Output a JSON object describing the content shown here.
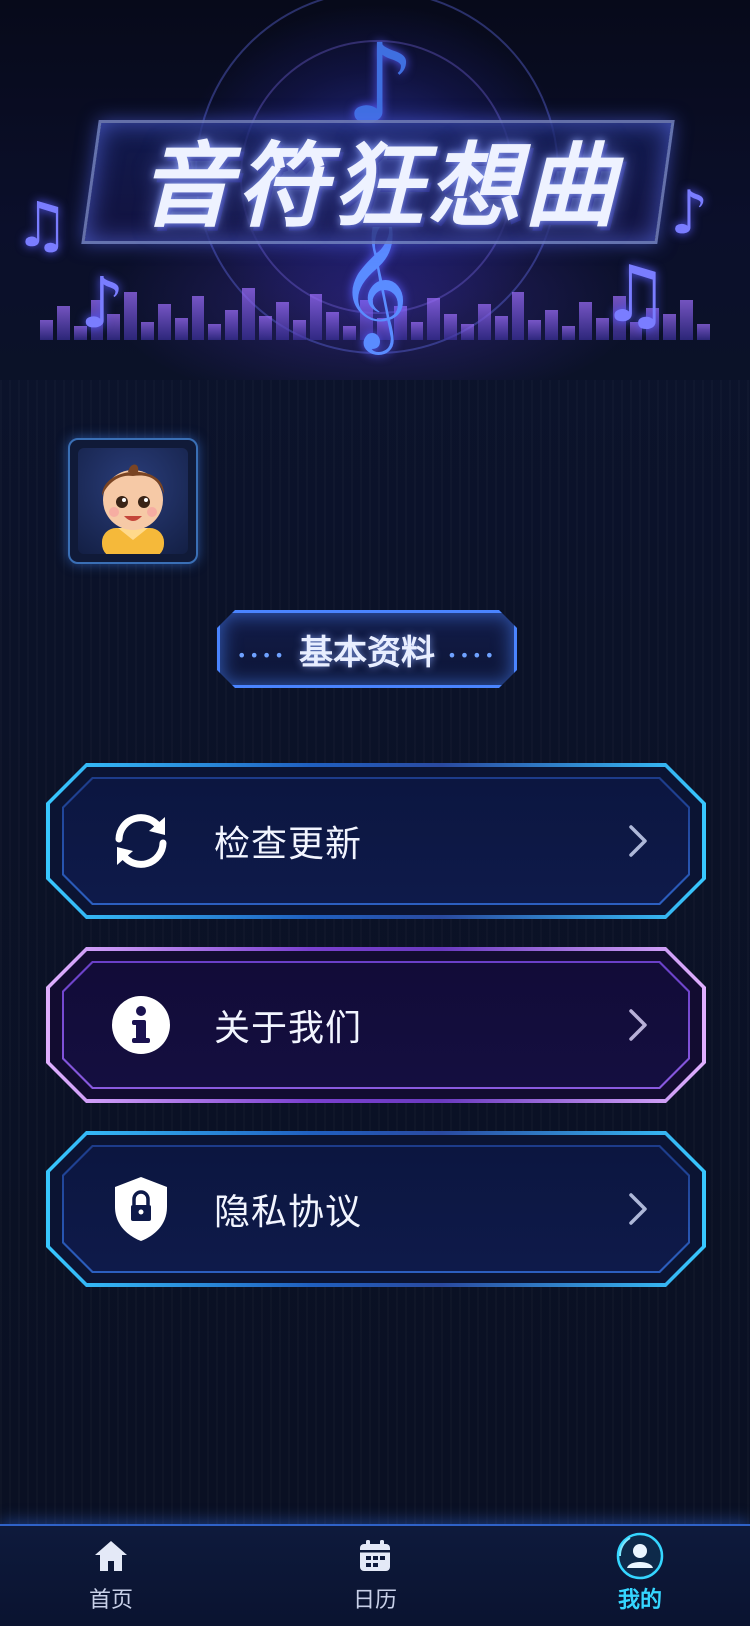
{
  "header": {
    "title": "音符狂想曲"
  },
  "profile": {
    "avatar_alt": "user-avatar",
    "section_label": "基本资料"
  },
  "menu": [
    {
      "id": "check-update",
      "label": "检查更新",
      "icon": "refresh-icon",
      "style": "blue"
    },
    {
      "id": "about-us",
      "label": "关于我们",
      "icon": "info-icon",
      "style": "purple"
    },
    {
      "id": "privacy-policy",
      "label": "隐私协议",
      "icon": "shield-lock-icon",
      "style": "blue"
    }
  ],
  "tabbar": {
    "items": [
      {
        "label": "首页",
        "icon": "home-icon",
        "active": false
      },
      {
        "label": "日历",
        "icon": "calendar-icon",
        "active": false
      },
      {
        "label": "我的",
        "icon": "profile-icon",
        "active": true
      }
    ]
  },
  "colors": {
    "accent_cyan": "#35d6ff",
    "accent_blue": "#4a84ff",
    "accent_purple": "#8a5ae0",
    "background": "#0a1020"
  }
}
